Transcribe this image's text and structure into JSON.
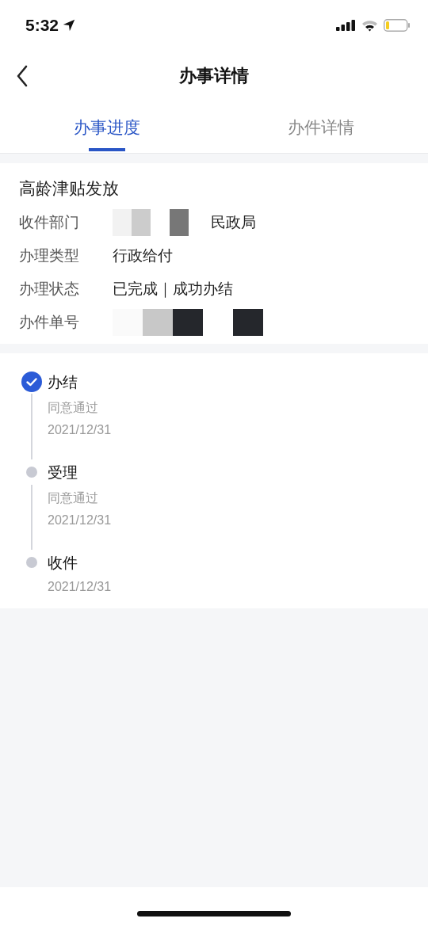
{
  "status_bar": {
    "time": "5:32"
  },
  "nav": {
    "title": "办事详情"
  },
  "tabs": [
    {
      "label": "办事进度",
      "selected": true
    },
    {
      "label": "办件详情",
      "selected": false
    }
  ],
  "case": {
    "title": "高龄津贴发放",
    "fields": [
      {
        "label": "收件部门",
        "value": "民政局",
        "redacted": true
      },
      {
        "label": "办理类型",
        "value": "行政给付",
        "redacted": false
      },
      {
        "label": "办理状态",
        "value": "已完成｜成功办结",
        "redacted": false
      },
      {
        "label": "办件单号",
        "redacted": true
      }
    ]
  },
  "steps": [
    {
      "title": "办结",
      "note": "同意通过",
      "date": "2021/12/31",
      "completed": true
    },
    {
      "title": "受理",
      "note": "同意通过",
      "date": "2021/12/31",
      "completed": false
    },
    {
      "title": "收件",
      "date": "2021/12/31",
      "completed": false
    }
  ]
}
